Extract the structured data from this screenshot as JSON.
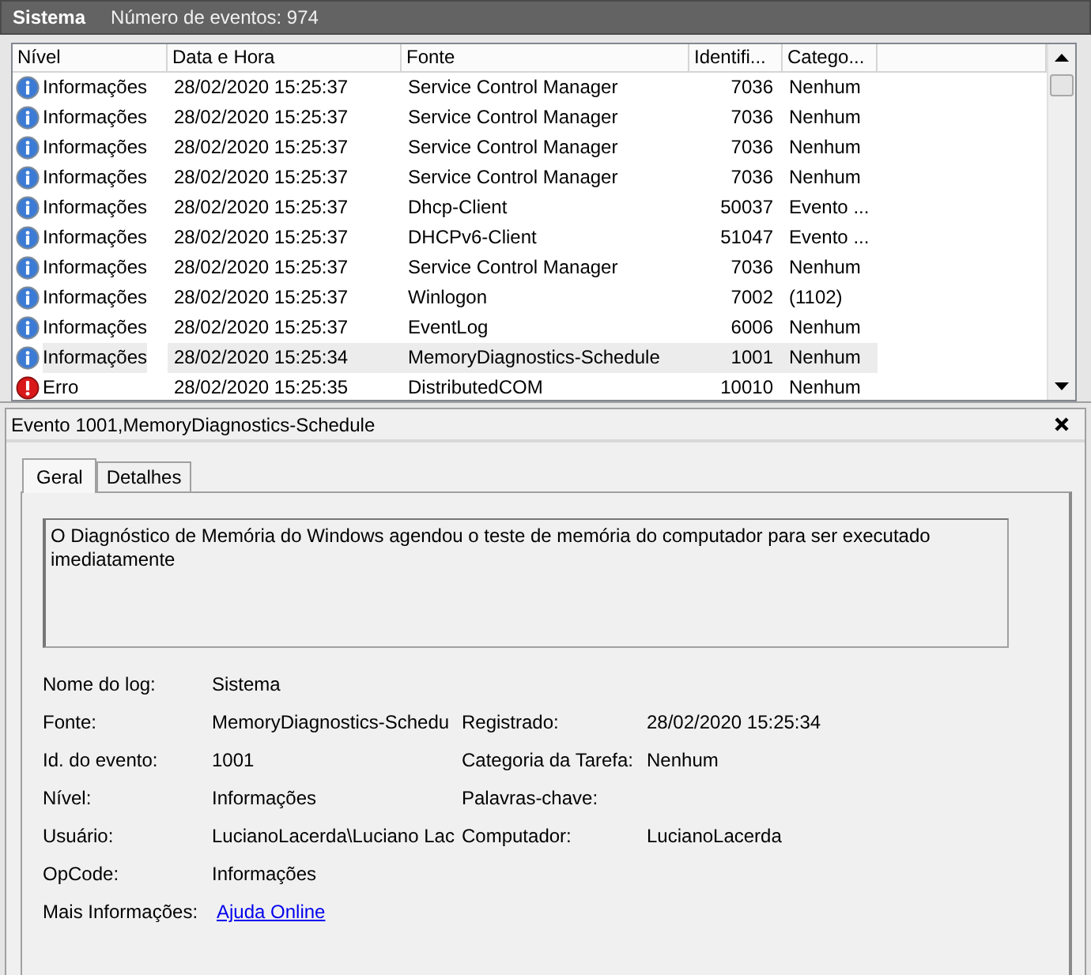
{
  "header": {
    "log_name": "Sistema",
    "event_count": "Número de eventos: 974"
  },
  "event_list": {
    "columns": [
      "Nível",
      "Data e Hora",
      "Fonte",
      "Identifi...",
      "Catego..."
    ],
    "rows": [
      {
        "kind": "info",
        "level": "Informações",
        "date": "28/02/2020 15:25:37",
        "source": "Service Control Manager",
        "id": "7036",
        "category": "Nenhum",
        "selected": false
      },
      {
        "kind": "info",
        "level": "Informações",
        "date": "28/02/2020 15:25:37",
        "source": "Service Control Manager",
        "id": "7036",
        "category": "Nenhum",
        "selected": false
      },
      {
        "kind": "info",
        "level": "Informações",
        "date": "28/02/2020 15:25:37",
        "source": "Service Control Manager",
        "id": "7036",
        "category": "Nenhum",
        "selected": false
      },
      {
        "kind": "info",
        "level": "Informações",
        "date": "28/02/2020 15:25:37",
        "source": "Service Control Manager",
        "id": "7036",
        "category": "Nenhum",
        "selected": false
      },
      {
        "kind": "info",
        "level": "Informações",
        "date": "28/02/2020 15:25:37",
        "source": "Dhcp-Client",
        "id": "50037",
        "category": "Evento ...",
        "selected": false
      },
      {
        "kind": "info",
        "level": "Informações",
        "date": "28/02/2020 15:25:37",
        "source": "DHCPv6-Client",
        "id": "51047",
        "category": "Evento ...",
        "selected": false
      },
      {
        "kind": "info",
        "level": "Informações",
        "date": "28/02/2020 15:25:37",
        "source": "Service Control Manager",
        "id": "7036",
        "category": "Nenhum",
        "selected": false
      },
      {
        "kind": "info",
        "level": "Informações",
        "date": "28/02/2020 15:25:37",
        "source": "Winlogon",
        "id": "7002",
        "category": "(1102)",
        "selected": false
      },
      {
        "kind": "info",
        "level": "Informações",
        "date": "28/02/2020 15:25:37",
        "source": "EventLog",
        "id": "6006",
        "category": "Nenhum",
        "selected": false
      },
      {
        "kind": "info",
        "level": "Informações",
        "date": "28/02/2020 15:25:34",
        "source": "MemoryDiagnostics-Schedule",
        "id": "1001",
        "category": "Nenhum",
        "selected": true
      },
      {
        "kind": "error",
        "level": "Erro",
        "date": "28/02/2020 15:25:35",
        "source": "DistributedCOM",
        "id": "10010",
        "category": "Nenhum",
        "selected": false
      }
    ]
  },
  "details": {
    "title": "Evento 1001,MemoryDiagnostics-Schedule",
    "tabs": [
      {
        "label": "Geral",
        "selected": true
      },
      {
        "label": "Detalhes",
        "selected": false
      }
    ],
    "message": "O Diagnóstico de Memória do Windows agendou o teste de memória do computador para ser executado imediatamente",
    "fields": [
      {
        "left": {
          "label": "Nome do log:",
          "value": "Sistema"
        }
      },
      {
        "left": {
          "label": "Fonte:",
          "value": "MemoryDiagnostics-Schedu"
        },
        "right": {
          "label": "Registrado:",
          "value": "28/02/2020 15:25:34"
        }
      },
      {
        "left": {
          "label": "Id. do evento:",
          "value": "1001"
        },
        "right": {
          "label": "Categoria da Tarefa:",
          "value": "Nenhum"
        }
      },
      {
        "left": {
          "label": "Nível:",
          "value": "Informações"
        },
        "right": {
          "label": "Palavras-chave:"
        }
      },
      {
        "left": {
          "label": "Usuário:",
          "value": "LucianoLacerda\\Luciano Lac"
        },
        "right": {
          "label": "Computador:",
          "value": "LucianoLacerda"
        }
      },
      {
        "left": {
          "label": "OpCode:",
          "value": "Informações"
        }
      },
      {
        "left": {
          "label": "Mais Informações:",
          "link": "Ajuda Online"
        }
      }
    ]
  }
}
